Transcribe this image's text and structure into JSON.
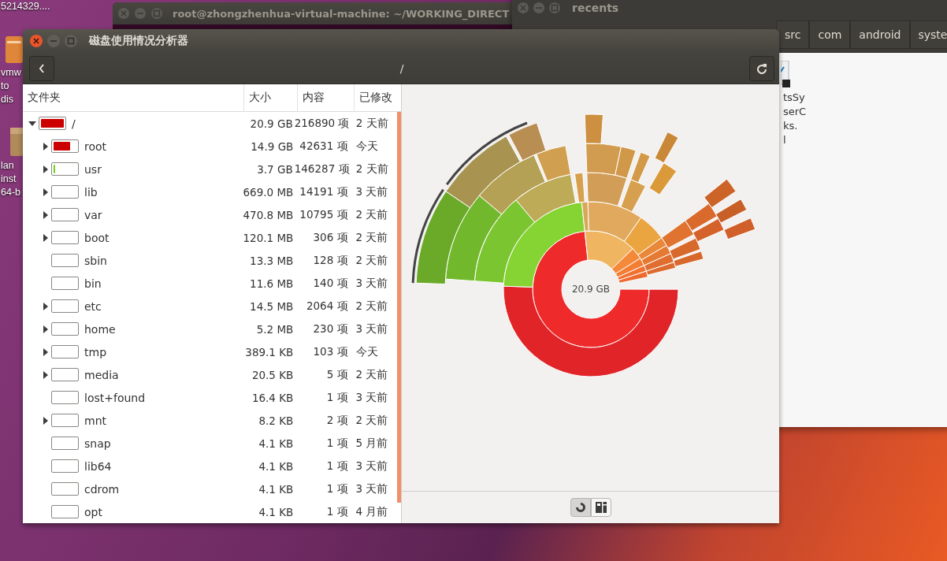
{
  "desktop": {
    "icons": [
      {
        "kind": "none",
        "label": "5214329...."
      },
      {
        "kind": "archive",
        "label": "vmw\nto\ndis"
      },
      {
        "kind": "package",
        "label": "lan\ninst\n64-b"
      }
    ]
  },
  "terminal_window": {
    "title": "root@zhongzhenhua-virtual-machine: ~/WORKING_DIRECT"
  },
  "files_window": {
    "title": "recents",
    "path_buttons": [
      "src",
      "com",
      "android",
      "syste"
    ],
    "file_label": "tsSy\nserC\nks.\nl"
  },
  "window": {
    "title": "磁盘使用情况分析器",
    "location": "/"
  },
  "table": {
    "columns": [
      "文件夹",
      "大小",
      "内容",
      "已修改"
    ],
    "rows": [
      {
        "name": "/",
        "size": "20.9 GB",
        "contents": "216890 项",
        "modified": "2 天前",
        "expandable": true,
        "expanded": true,
        "level": 1.0,
        "color": "#cc0000",
        "children": [
          {
            "name": "root",
            "size": "14.9 GB",
            "contents": "42631 项",
            "modified": "今天",
            "expandable": true,
            "expanded": false,
            "level": 0.71,
            "color": "#cc0000"
          },
          {
            "name": "usr",
            "size": "3.7 GB",
            "contents": "146287 项",
            "modified": "2 天前",
            "expandable": true,
            "expanded": false,
            "level": 0.07,
            "color": "#73d216"
          },
          {
            "name": "lib",
            "size": "669.0 MB",
            "contents": "14191 项",
            "modified": "3 天前",
            "expandable": true,
            "expanded": false
          },
          {
            "name": "var",
            "size": "470.8 MB",
            "contents": "10795 项",
            "modified": "2 天前",
            "expandable": true,
            "expanded": false
          },
          {
            "name": "boot",
            "size": "120.1 MB",
            "contents": "306 项",
            "modified": "2 天前",
            "expandable": true,
            "expanded": false
          },
          {
            "name": "sbin",
            "size": "13.3 MB",
            "contents": "128 项",
            "modified": "2 天前",
            "expandable": false
          },
          {
            "name": "bin",
            "size": "11.6 MB",
            "contents": "140 项",
            "modified": "3 天前",
            "expandable": false
          },
          {
            "name": "etc",
            "size": "14.5 MB",
            "contents": "2064 项",
            "modified": "2 天前",
            "expandable": true,
            "expanded": false
          },
          {
            "name": "home",
            "size": "5.2 MB",
            "contents": "230 项",
            "modified": "3 天前",
            "expandable": true,
            "expanded": false
          },
          {
            "name": "tmp",
            "size": "389.1 KB",
            "contents": "103 项",
            "modified": "今天",
            "expandable": true,
            "expanded": false
          },
          {
            "name": "media",
            "size": "20.5 KB",
            "contents": "5 项",
            "modified": "2 天前",
            "expandable": true,
            "expanded": false
          },
          {
            "name": "lost+found",
            "size": "16.4 KB",
            "contents": "1 项",
            "modified": "3 天前",
            "expandable": false
          },
          {
            "name": "mnt",
            "size": "8.2 KB",
            "contents": "2 项",
            "modified": "2 天前",
            "expandable": true,
            "expanded": false
          },
          {
            "name": "snap",
            "size": "4.1 KB",
            "contents": "1 项",
            "modified": "5 月前",
            "expandable": false
          },
          {
            "name": "lib64",
            "size": "4.1 KB",
            "contents": "1 项",
            "modified": "3 天前",
            "expandable": false
          },
          {
            "name": "cdrom",
            "size": "4.1 KB",
            "contents": "1 项",
            "modified": "3 天前",
            "expandable": false
          },
          {
            "name": "opt",
            "size": "4.1 KB",
            "contents": "1 项",
            "modified": "4 月前",
            "expandable": false
          }
        ]
      }
    ]
  },
  "chart": {
    "center_label": "20.9 GB"
  },
  "view_buttons": [
    {
      "kind": "rings",
      "selected": true
    },
    {
      "kind": "treemap",
      "selected": false
    }
  ]
}
